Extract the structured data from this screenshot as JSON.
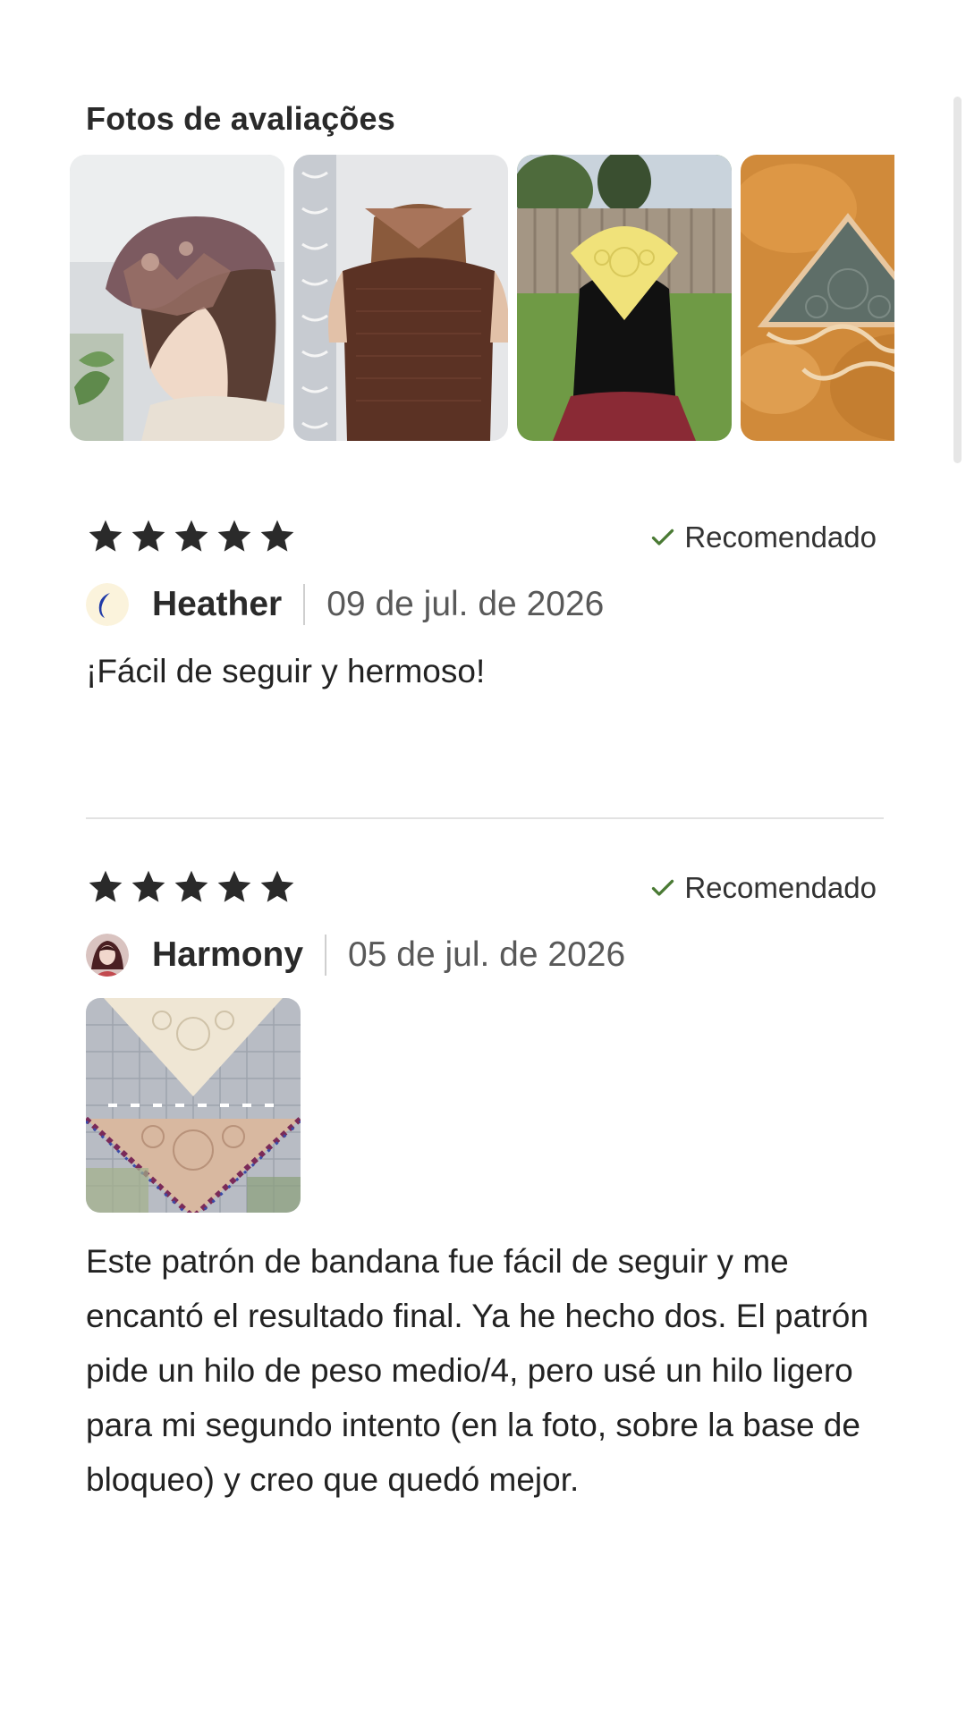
{
  "section": {
    "title": "Fotos de avaliações"
  },
  "photos": [
    {
      "icon": "photo-woman-patterned-bandana"
    },
    {
      "icon": "photo-brown-vest-bandana"
    },
    {
      "icon": "photo-yellow-bandana-garden"
    },
    {
      "icon": "photo-orange-tie-dye-bandana"
    }
  ],
  "reviews": [
    {
      "rating": 5,
      "recommended_label": "Recomendado",
      "author": "Heather",
      "date": "09 de jul. de 2026",
      "text": "¡Fácil de seguir y hermoso!",
      "avatar_icon": "crescent-moon-avatar"
    },
    {
      "rating": 5,
      "recommended_label": "Recomendado",
      "author": "Harmony",
      "date": "05 de jul. de 2026",
      "text": "Este patrón de bandana fue fácil de seguir y me encantó el resultado final. Ya he hecho dos. El patrón pide un hilo de peso medio/4, pero usé un hilo ligero para mi segundo intento (en la foto, sobre la base de bloqueo) y creo que quedó mejor.",
      "avatar_icon": "profile-photo-avatar",
      "photo_icon": "photo-bandanas-on-blocking-board"
    }
  ],
  "colors": {
    "star": "#2a2a2a",
    "check": "#4a7a34",
    "divider": "#e2e2e2"
  }
}
